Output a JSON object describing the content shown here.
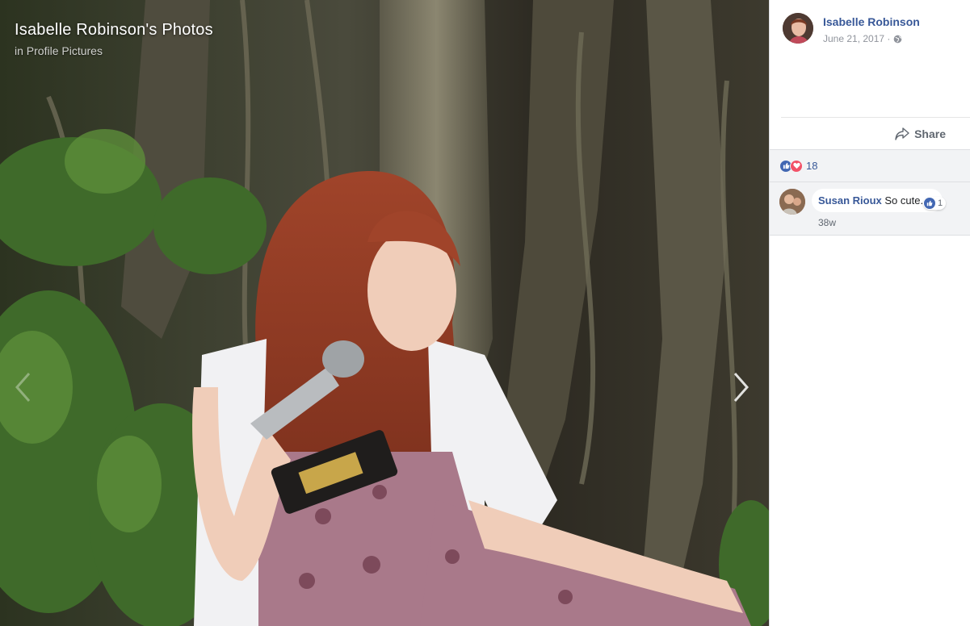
{
  "photo": {
    "title": "Isabelle Robinson's Photos",
    "album_prefix": "in",
    "album_name": "Profile Pictures"
  },
  "post": {
    "author": "Isabelle Robinson",
    "date": "June 21, 2017 ·",
    "privacy_icon": "globe-icon",
    "share_label": "Share"
  },
  "reactions": {
    "icons": [
      "like-icon",
      "love-icon"
    ],
    "count": "18",
    "colors": {
      "like": "#4267b2",
      "love": "#f25268"
    }
  },
  "comments": [
    {
      "author": "Susan Rioux",
      "text": "So cute.",
      "likes": "1",
      "time": "38w"
    }
  ],
  "colors": {
    "link": "#385898",
    "meta": "#90949c",
    "panel_bg": "#f2f3f5"
  }
}
